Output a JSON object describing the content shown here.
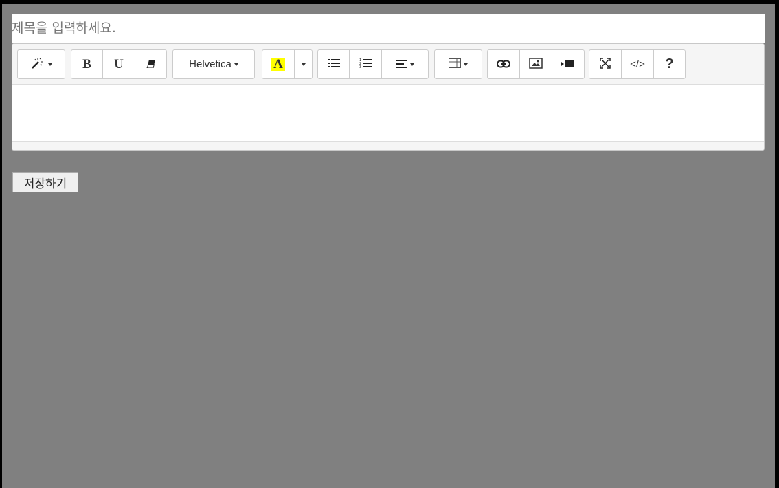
{
  "title_input": {
    "placeholder": "제목을 입력하세요."
  },
  "toolbar": {
    "bold_label": "B",
    "underline_label": "U",
    "font_name": "Helvetica",
    "fore_color_label": "A",
    "fore_color_highlight": "#ffff00",
    "code_view_label": "</>",
    "help_label": "?",
    "icons": [
      "magic-icon",
      "bold-icon",
      "underline-icon",
      "eraser-icon",
      "font-color-icon",
      "unordered-list-icon",
      "ordered-list-icon",
      "align-left-icon",
      "table-icon",
      "link-icon",
      "picture-icon",
      "video-icon",
      "fullscreen-icon",
      "code-view-icon",
      "help-icon"
    ]
  },
  "save_button": {
    "label": "저장하기"
  }
}
